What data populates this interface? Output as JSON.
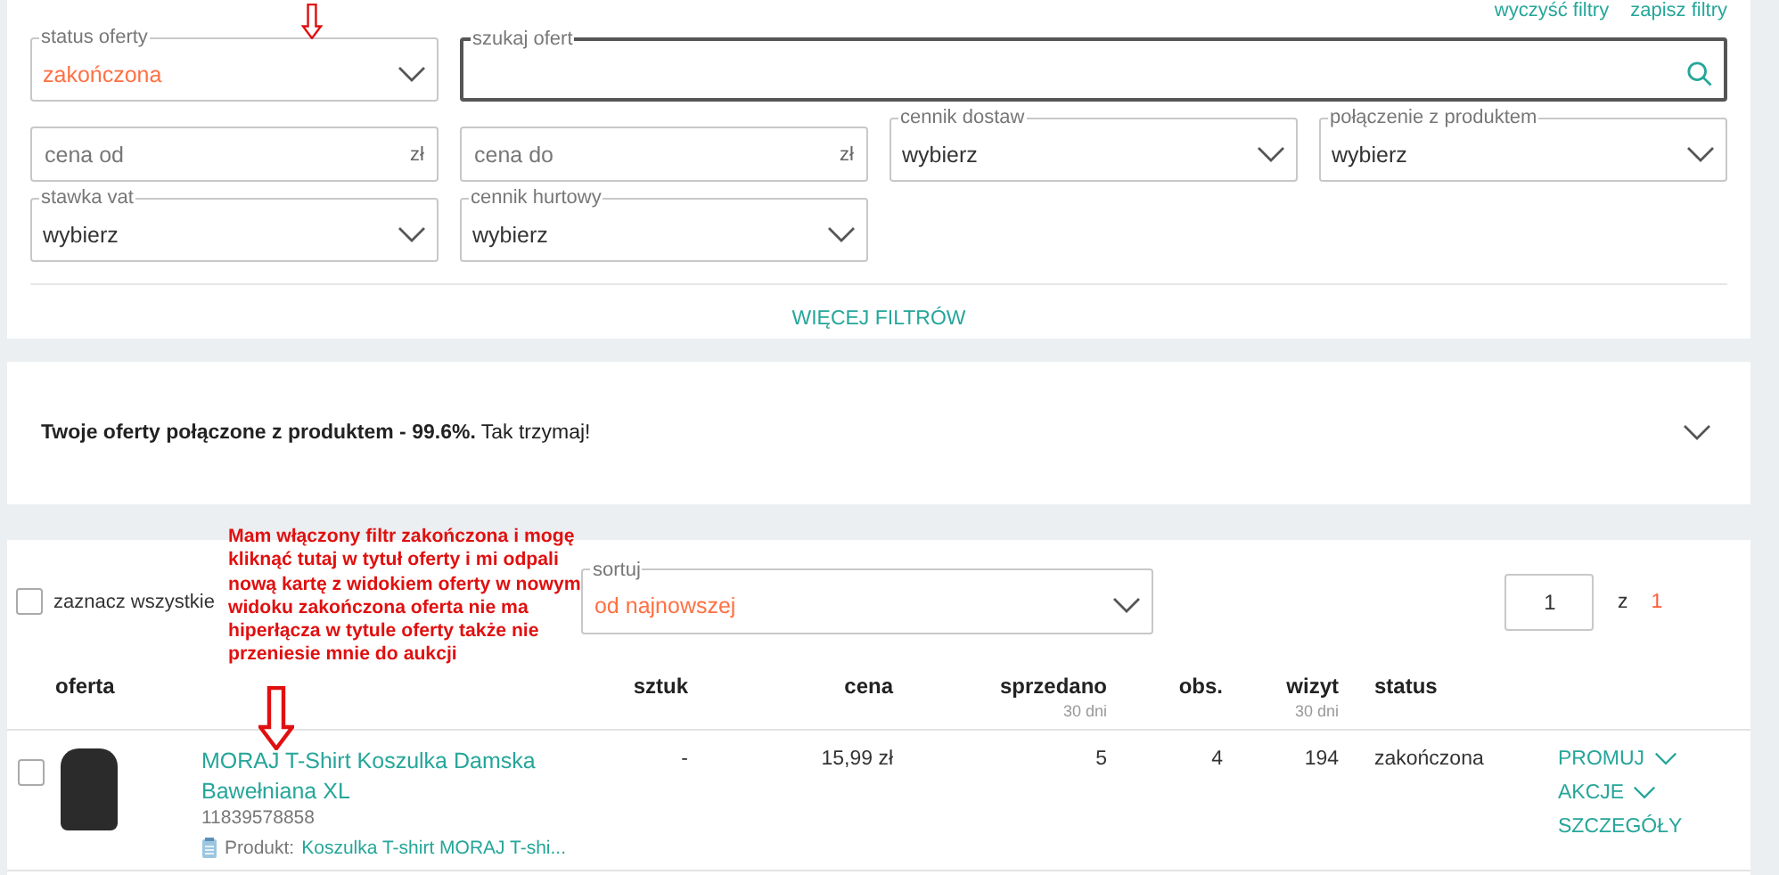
{
  "filter_links": [
    "wyczyść filtry",
    "zapisz filtry"
  ],
  "filters": [
    {
      "kind": "select",
      "label": "status oferty",
      "value": "zakończona",
      "active": true
    },
    {
      "kind": "search",
      "label": "szukaj ofert",
      "focused": true
    },
    {
      "kind": "price",
      "placeholder": "cena od",
      "unit": "zł"
    },
    {
      "kind": "price",
      "placeholder": "cena do",
      "unit": "zł"
    },
    {
      "kind": "select",
      "label": "cennik dostaw",
      "value": "wybierz",
      "active": false
    },
    {
      "kind": "select",
      "label": "połączenie z produktem",
      "value": "wybierz",
      "active": false
    },
    {
      "kind": "select",
      "label": "stawka vat",
      "value": "wybierz",
      "active": false
    },
    {
      "kind": "select",
      "label": "cennik hurtowy",
      "value": "wybierz",
      "active": false
    }
  ],
  "more_filters": "WIĘCEJ FILTRÓW",
  "product_summary": {
    "text": "**Twoje oferty połączone z produktem - 99.6%.** Tak trzymaj!",
    "expanded": false
  },
  "offers": {
    "select_all": {
      "label": "zaznacz wszystkie",
      "checked": false
    },
    "sort": {
      "label": "sortuj",
      "value": "od najnowszej",
      "active": true
    },
    "pagination": {
      "page": "1",
      "separator": "z",
      "total": "1"
    },
    "columns": [
      {
        "label": "oferta"
      },
      {
        "label": "sztuk"
      },
      {
        "label": "cena"
      },
      {
        "label": "sprzedano",
        "note": "30 dni"
      },
      {
        "label": "obs."
      },
      {
        "label": "wizyt",
        "note": "30 dni"
      },
      {
        "label": "status"
      }
    ],
    "rows": [
      {
        "checked": false,
        "offer": {
          "title": "MORAJ T-Shirt Koszulka Damska Bawełniana XL",
          "number": "11839578858",
          "product_label": "Produkt:",
          "product_name": "Koszulka T-shirt MORAJ T-shi..."
        },
        "quantity": "-",
        "price": "15,99 zł",
        "sold": "5",
        "watchers": "4",
        "visits": "194",
        "status": "zakończona",
        "actions": [
          {
            "label": "PROMUJ",
            "dropdown": true
          },
          {
            "label": "AKCJE",
            "dropdown": true
          },
          {
            "label": "SZCZEGÓŁY",
            "dropdown": false
          }
        ]
      }
    ]
  },
  "annotation": {
    "text": "Mam włączony filtr zakończona i mogę kliknąć tutaj w tytuł oferty i mi odpali nową kartę z widokiem oferty w nowym widoku zakończona oferta nie ma hiperłącza w tytule oferty także nie przeniesie mnie do aukcji"
  }
}
